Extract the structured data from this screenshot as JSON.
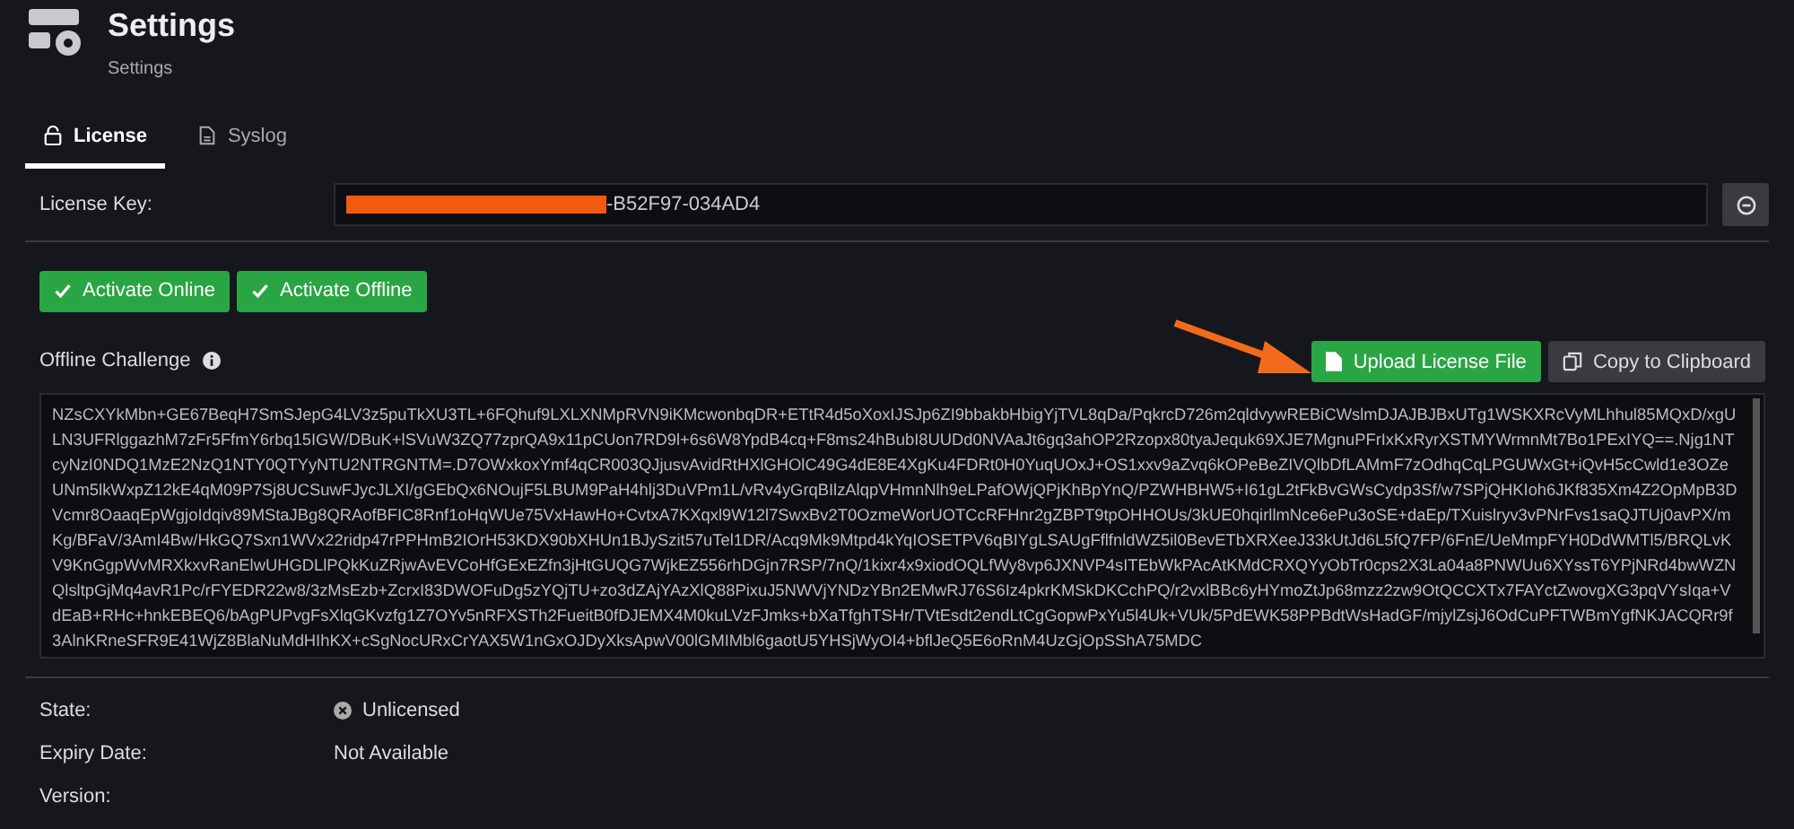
{
  "header": {
    "title": "Settings",
    "subtitle": "Settings"
  },
  "tabs": [
    {
      "label": "License",
      "selected": true,
      "kind": "lock"
    },
    {
      "label": "Syslog",
      "selected": false,
      "kind": "log"
    }
  ],
  "license_key": {
    "label": "License Key:",
    "value": "-B52F97-034AD4",
    "redacted": true
  },
  "activation_buttons": [
    {
      "label": "Activate Online"
    },
    {
      "label": "Activate Offline"
    }
  ],
  "offline_challenge": {
    "label": "Offline Challenge",
    "buttons": [
      {
        "label": "Upload License File",
        "kind": "upload"
      },
      {
        "label": "Copy to Clipboard",
        "kind": "copy"
      }
    ],
    "text": "NZsCXYkMbn+GE67BeqH7SmSJepG4LV3z5puTkXU3TL+6FQhuf9LXLXNMpRVN9iKMcwonbqDR+ETtR4d5oXoxIJSJp6ZI9bbakbHbigYjTVL8qDa/PqkrcD726m2qldvywREBiCWslmDJAJBJBxUTg1WSKXRcVyMLhhul85MQxD/xgULN3UFRlggazhM7zFr5FfmY6rbq15IGW/DBuK+lSVuW3ZQ77zprQA9x11pCUon7RD9l+6s6W8YpdB4cq+F8ms24hBubI8UUDd0NVAaJt6gq3ahOP2Rzopx80tyaJequk69XJE7MgnuPFrIxKxRyrXSTMYWrmnMt7Bo1PExIYQ==.Njg1NTcyNzI0NDQ1MzE2NzQ1NTY0QTYyNTU2NTRGNTM=.D7OWxkoxYmf4qCR003QJjusvAvidRtHXlGHOlC49G4dE8E4XgKu4FDRt0H0YuqUOxJ+OS1xxv9aZvq6kOPeBeZIVQlbDfLAMmF7zOdhqCqLPGUWxGt+iQvH5cCwld1e3OZeUNm5lkWxpZ12kE4qM09P7Sj8UCSuwFJycJLXI/gGEbQx6NOujF5LBUM9PaH4hlj3DuVPm1L/vRv4yGrqBIlzAlqpVHmnNlh9eLPafOWjQPjKhBpYnQ/PZWHBHW5+I61gL2tFkBvGWsCydp3Sf/w7SPjQHKIoh6JKf835Xm4Z2OpMpB3DVcmr8OaaqEpWgjoIdqiv89MStaJBg8QRAofBFIC8Rnf1oHqWUe75VxHawHo+CvtxA7KXqxl9W12l7SwxBv2T0OzmeWorUOTCcRFHnr2gZBPT9tpOHHOUs/3kUE0hqirllmNce6ePu3oSE+daEp/TXuislryv3vPNrFvs1saQJTUj0avPX/mKg/BFaV/3AmI4Bw/HkGQ7Sxn1WVx22ridp47rPPHmB2IOrH53KDX90bXHUn1BJySzit57uTel1DR/Acq9Mk9Mtpd4kYqIOSETPV6qBIYgLSAUgFflfnldWZ5il0BevETbXRXeeJ33kUtJd6L5fQ7FP/6FnE/UeMmpFYH0DdWMTl5/BRQLvKV9KnGgpWvMRXkxvRanElwUHGDLlPQkKuZRjwAvEVCoHfGExEZfn3jHtGUQG7WjkEZ556rhDGjn7RSP/7nQ/1kixr4x9xiodOQLfWy8vp6JXNVP4sITEbWkPAcAtKMdCRXQYyObTr0cps2X3La04a8PNWUu6XYssT6YPjNRd4bwWZNQlsltpGjMq4avR1Pc/rFYEDR22w8/3zMsEzb+ZcrxI83DWOFuDg5zYQjTU+zo3dZAjYAzXlQ88PixuJ5NWVjYNDzYBn2EMwRJ76S6Iz4pkrKMSkDKCchPQ/r2vxlBBc6yHYmoZtJp68mzz2zw9OtQCCXTx7FAYctZwovgXG3pqVYsIqa+VdEaB+RHc+hnkEBEQ6/bAgPUPvgFsXlqGKvzfg1Z7OYv5nRFXSTh2FueitB0fDJEMX4M0kuLVzFJmks+bXaTfghTSHr/TVtEsdt2endLtCgGopwPxYu5l4Uk+VUk/5PdEWK58PPBdtWsHadGF/mjylZsjJ6OdCuPFTWBmYgfNKJACQRr9f3AlnKRneSFR9E41WjZ8BlaNuMdHIhKX+cSgNocURxCrYAX5W1nGxOJDyXksApwV00lGMIMbl6gaotU5YHSjWyOI4+bflJeQ5E6oRnM4UzGjOpSShA75MDC"
  },
  "details": [
    {
      "label": "State:",
      "value": "Unlicensed",
      "kind": "status"
    },
    {
      "label": "Expiry Date:",
      "value": "Not Available"
    },
    {
      "label": "Version:"
    }
  ]
}
